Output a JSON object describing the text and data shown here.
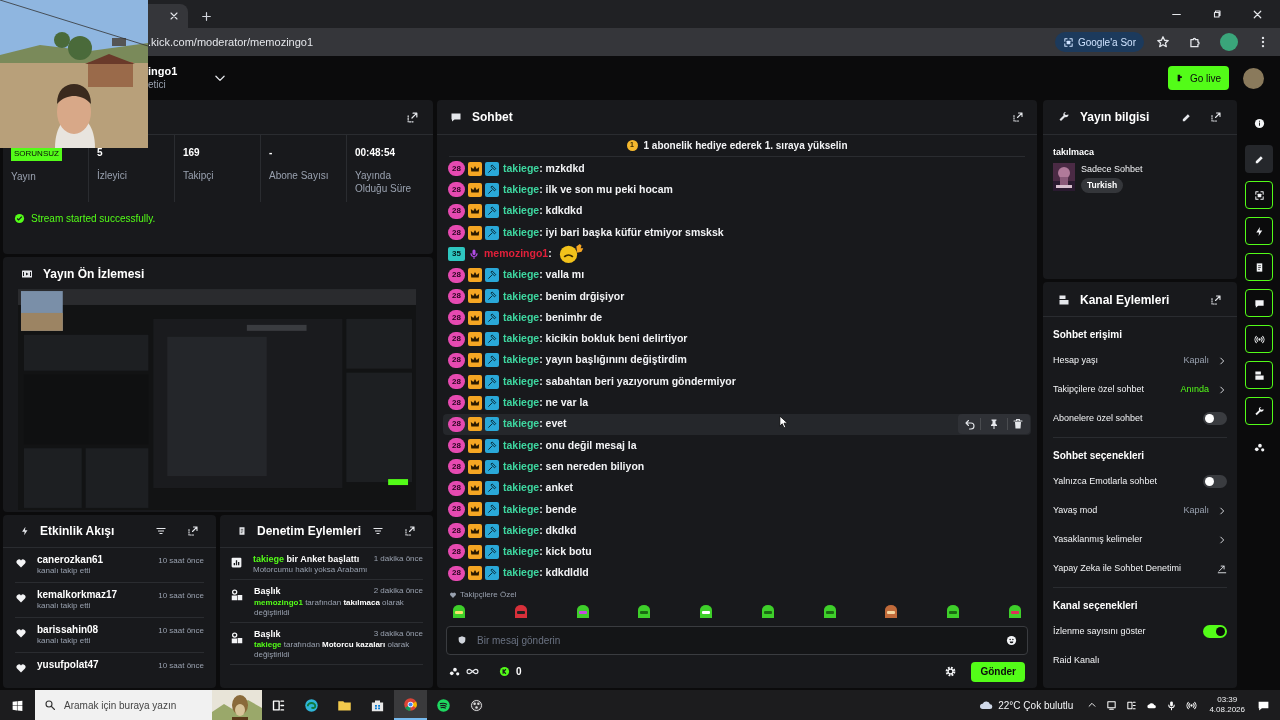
{
  "browser": {
    "url": ".kick.com/moderator/memozingo1",
    "ask_button": "Google'a Sor"
  },
  "header": {
    "channel_name": "ingo1",
    "channel_role": "etici",
    "go_live": "Go live"
  },
  "stream_card": {
    "stats": [
      {
        "kind": "badge",
        "value": "SORUNSUZ",
        "label": "Yayın"
      },
      {
        "kind": "number",
        "value": "5",
        "label": "İzleyici"
      },
      {
        "kind": "number",
        "value": "169",
        "label": "Takipçi"
      },
      {
        "kind": "number",
        "value": "-",
        "label": "Abone Sayısı"
      },
      {
        "kind": "number",
        "value": "00:48:54",
        "label": "Yayında Olduğu Süre"
      }
    ],
    "message": "Stream started successfully."
  },
  "preview": {
    "title": "Yayın Ön İzlemesi"
  },
  "activity": {
    "title": "Etkinlik Akışı",
    "events": [
      {
        "user": "canerozkan61",
        "action": "kanalı takip etti",
        "time": "10 saat önce"
      },
      {
        "user": "kemalkorkmaz17",
        "action": "kanalı takip etti",
        "time": "10 saat önce"
      },
      {
        "user": "barissahin08",
        "action": "kanalı takip etti",
        "time": "10 saat önce"
      },
      {
        "user": "yusufpolat47",
        "time": "10 saat önce"
      }
    ]
  },
  "moderation": {
    "title": "Denetim Eylemleri",
    "items": [
      {
        "kind": "poll",
        "actor": "takiege",
        "action": "bir Anket başlattı",
        "time": "1 dakika önce",
        "detail": "Motorcumu haklı yoksa Arabamı"
      },
      {
        "kind": "title",
        "heading": "Başlık",
        "time": "2 dakika önce",
        "actor": "memozingo1",
        "middle": "tarafından",
        "value": "takılmaca",
        "suffix": "olarak değiştirildi"
      },
      {
        "kind": "title",
        "heading": "Başlık",
        "time": "3 dakika önce",
        "actor": "takiege",
        "middle": "tarafından",
        "value": "Motorcu kazaları",
        "suffix": "olarak değiştirildi"
      }
    ]
  },
  "chat": {
    "title": "Sohbet",
    "banner_rank": "1",
    "banner": "1 abonelik hediye ederek 1. sıraya yükselin",
    "separator": ":",
    "messages": [
      {
        "kind": "moderator",
        "badge": "28",
        "user": "takiege",
        "text": "mzkdkd",
        "hovered": false
      },
      {
        "kind": "moderator",
        "badge": "28",
        "user": "takiege",
        "text": "ilk ve son mu peki hocam",
        "hovered": false
      },
      {
        "kind": "moderator",
        "badge": "28",
        "user": "takiege",
        "text": "kdkdkd",
        "hovered": false
      },
      {
        "kind": "moderator",
        "badge": "28",
        "user": "takiege",
        "text": "iyi bari başka küfür etmiyor smsksk",
        "hovered": false
      },
      {
        "kind": "broadcaster",
        "badge": "35",
        "user": "memozingo1",
        "hovered": false
      },
      {
        "kind": "moderator",
        "badge": "28",
        "user": "takiege",
        "text": "valla mı",
        "hovered": false
      },
      {
        "kind": "moderator",
        "badge": "28",
        "user": "takiege",
        "text": "benim drğişiyor",
        "hovered": false
      },
      {
        "kind": "moderator",
        "badge": "28",
        "user": "takiege",
        "text": "benimhr de",
        "hovered": false
      },
      {
        "kind": "moderator",
        "badge": "28",
        "user": "takiege",
        "text": "kicikin bokluk beni delirtiyor",
        "hovered": false
      },
      {
        "kind": "moderator",
        "badge": "28",
        "user": "takiege",
        "text": "yayın başlığınını değiştirdim",
        "hovered": false
      },
      {
        "kind": "moderator",
        "badge": "28",
        "user": "takiege",
        "text": "sabahtan beri yazıyorum göndermiyor",
        "hovered": false
      },
      {
        "kind": "moderator",
        "badge": "28",
        "user": "takiege",
        "text": "ne var la",
        "hovered": false
      },
      {
        "kind": "moderator",
        "badge": "28",
        "user": "takiege",
        "text": "evet",
        "hovered": true
      },
      {
        "kind": "moderator",
        "badge": "28",
        "user": "takiege",
        "text": "onu değil mesaj la",
        "hovered": false
      },
      {
        "kind": "moderator",
        "badge": "28",
        "user": "takiege",
        "text": "sen nereden biliyon",
        "hovered": false
      },
      {
        "kind": "moderator",
        "badge": "28",
        "user": "takiege",
        "text": "anket",
        "hovered": false
      },
      {
        "kind": "moderator",
        "badge": "28",
        "user": "takiege",
        "text": "bende",
        "hovered": false
      },
      {
        "kind": "moderator",
        "badge": "28",
        "user": "takiege",
        "text": "dkdkd",
        "hovered": false
      },
      {
        "kind": "moderator",
        "badge": "28",
        "user": "takiege",
        "text": "kick botu",
        "hovered": false
      },
      {
        "kind": "moderator",
        "badge": "28",
        "user": "takiege",
        "text": "kdkdldld",
        "hovered": false
      }
    ],
    "emote_section": "Takipçilere Özel",
    "input": {
      "placeholder": "Bir mesaj gönderin"
    },
    "points": "0",
    "send": "Gönder"
  },
  "stream_info": {
    "title": "Yayın bilgisi",
    "stream_title": "takılmaca",
    "category": "Sadece Sohbet",
    "tag": "Turkish"
  },
  "channel_actions": {
    "title": "Kanal Eylemleri",
    "sections": [
      {
        "heading": "Sohbet erişimi",
        "rows": [
          {
            "kind": "value",
            "label": "Hesap yaşı",
            "value": "Kapalı",
            "accent": false
          },
          {
            "kind": "value",
            "label": "Takipçilere özel sohbet",
            "value": "Anında",
            "accent": true
          },
          {
            "kind": "toggle",
            "label": "Abonelere özel sohbet",
            "on": false
          }
        ]
      },
      {
        "heading": "Sohbet seçenekleri",
        "rows": [
          {
            "kind": "toggle",
            "label": "Yalnızca Emotlarla sohbet",
            "on": false
          },
          {
            "kind": "value",
            "label": "Yavaş mod",
            "value": "Kapalı",
            "accent": false
          },
          {
            "kind": "link",
            "label": "Yasaklanmış kelimeler"
          },
          {
            "kind": "external",
            "label": "Yapay Zeka ile Sohbet Denetimi"
          }
        ]
      },
      {
        "heading": "Kanal seçenekleri",
        "rows": [
          {
            "kind": "toggle",
            "label": "İzlenme sayısını göster",
            "on": true
          },
          {
            "kind": "plain",
            "label": "Raid Kanalı"
          }
        ]
      }
    ]
  },
  "rail": [
    {
      "kind": "info",
      "boxed": false,
      "selected": false
    },
    {
      "kind": "pencil",
      "boxed": false,
      "selected": true
    },
    {
      "kind": "focus",
      "boxed": true,
      "selected": false
    },
    {
      "kind": "bolt",
      "boxed": true,
      "selected": false
    },
    {
      "kind": "doc",
      "boxed": true,
      "selected": false
    },
    {
      "kind": "chat",
      "boxed": true,
      "selected": false
    },
    {
      "kind": "broadcast",
      "boxed": true,
      "selected": false
    },
    {
      "kind": "panel",
      "boxed": true,
      "selected": false
    },
    {
      "kind": "wrench",
      "boxed": true,
      "selected": false
    },
    {
      "kind": "dots",
      "boxed": false,
      "selected": false
    }
  ],
  "taskbar": {
    "search_placeholder": "Aramak için buraya yazın",
    "apps": [
      {
        "kind": "taskview",
        "active": false
      },
      {
        "kind": "edge",
        "active": false
      },
      {
        "kind": "folder",
        "active": false
      },
      {
        "kind": "store",
        "active": false
      },
      {
        "kind": "chrome",
        "active": true
      },
      {
        "kind": "music",
        "active": false
      },
      {
        "kind": "record",
        "active": false
      }
    ],
    "weather": "22°C Çok bulutlu",
    "time": "03:39",
    "date": "4.08.2026"
  }
}
